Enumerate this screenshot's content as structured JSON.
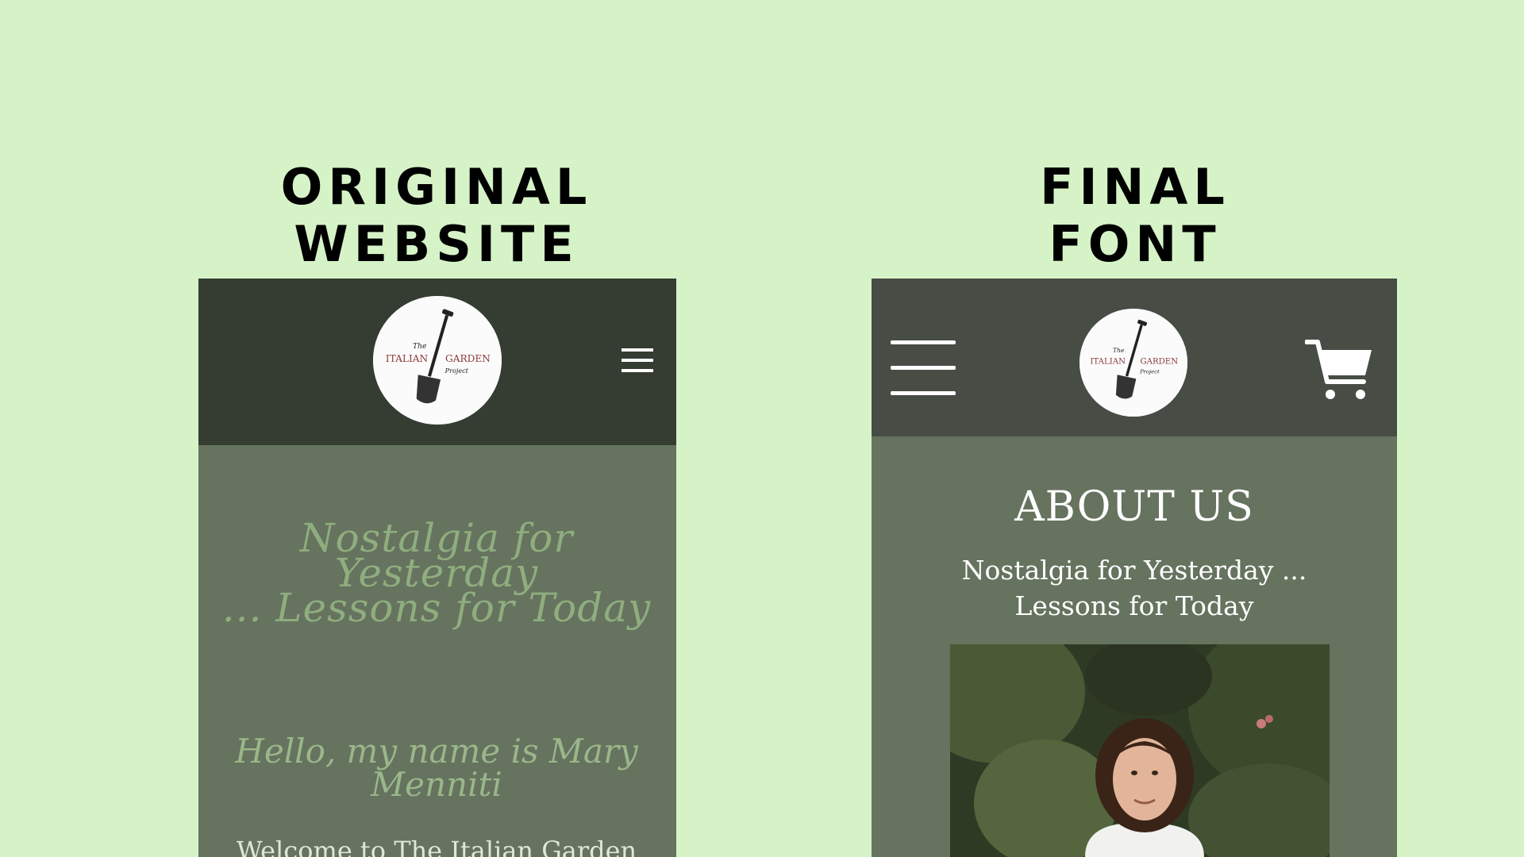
{
  "captions": {
    "left_line1": "ORIGINAL",
    "left_line2": "WEBSITE",
    "right_line1": "FINAL",
    "right_line2": "FONT"
  },
  "logo": {
    "top_small": "The",
    "left_word": "ITALIAN",
    "right_word": "GARDEN",
    "bottom_small": "Project"
  },
  "original": {
    "slogan_line1": "Nostalgia for Yesterday",
    "slogan_line2": "... Lessons for Today",
    "hello_line1": "Hello, my name is Mary",
    "hello_line2": "Menniti",
    "welcome": "Welcome to The Italian Garden"
  },
  "final": {
    "title": "ABOUT US",
    "slogan_line1": "Nostalgia for Yesterday ...",
    "slogan_line2": "Lessons for Today"
  },
  "colors": {
    "background": "#d6f3c7",
    "original_header": "#353d33",
    "final_header": "#474c45",
    "body_green": "#65735f",
    "script_green": "#8fad7e",
    "logo_red": "#8b3a3a"
  },
  "icons": [
    "menu-icon",
    "cart-icon",
    "shovel-icon"
  ]
}
